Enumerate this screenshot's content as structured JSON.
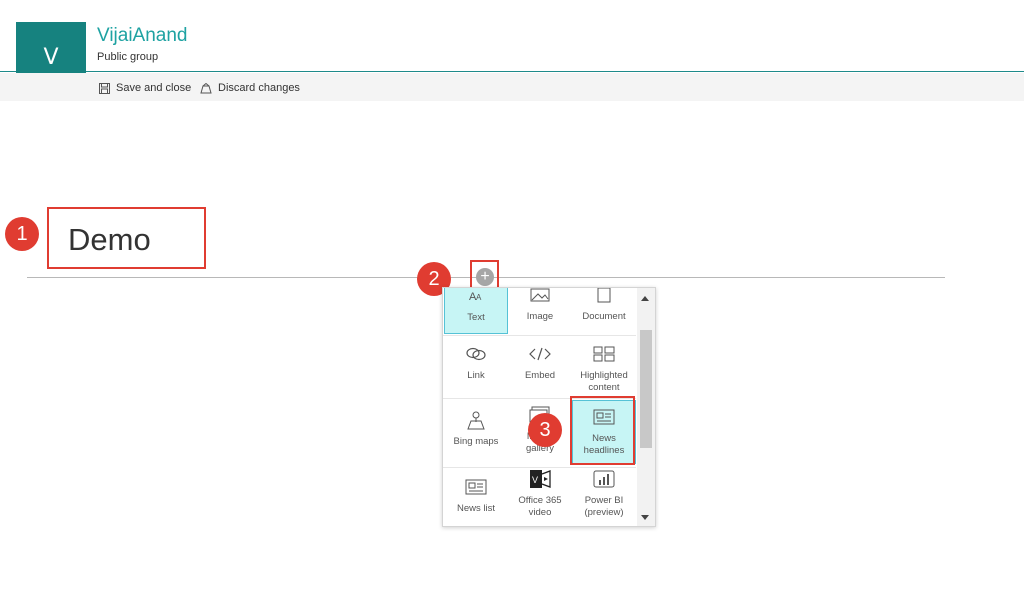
{
  "site": {
    "logo_letter": "V",
    "title": "VijaiAnand",
    "subtitle": "Public group"
  },
  "command_bar": {
    "save_label": "Save and close",
    "discard_label": "Discard changes"
  },
  "page": {
    "title": "Demo"
  },
  "add_button": {
    "symbol": "+"
  },
  "steps": [
    "1",
    "2",
    "3"
  ],
  "toolbox": {
    "items": [
      {
        "label": "Text",
        "icon": "text-icon",
        "selected": true
      },
      {
        "label": "Image",
        "icon": "image-icon"
      },
      {
        "label": "Document",
        "icon": "document-icon"
      },
      {
        "label": "Link",
        "icon": "link-icon"
      },
      {
        "label": "Embed",
        "icon": "embed-icon"
      },
      {
        "label": "Highlighted content",
        "icon": "highlighted-content-icon"
      },
      {
        "label": "Bing maps",
        "icon": "map-icon"
      },
      {
        "label": "Image gallery",
        "icon": "image-gallery-icon"
      },
      {
        "label": "News headlines",
        "icon": "news-icon",
        "selected": true
      },
      {
        "label": "News list",
        "icon": "news-list-icon"
      },
      {
        "label": "Office 365 video",
        "icon": "video-icon"
      },
      {
        "label": "Power BI (preview)",
        "icon": "power-bi-icon"
      }
    ]
  },
  "colors": {
    "brand": "#16827f",
    "accent_text": "#1ea2a2",
    "highlight_red": "#e03c31",
    "selected_tile": "#c7f5f5"
  }
}
